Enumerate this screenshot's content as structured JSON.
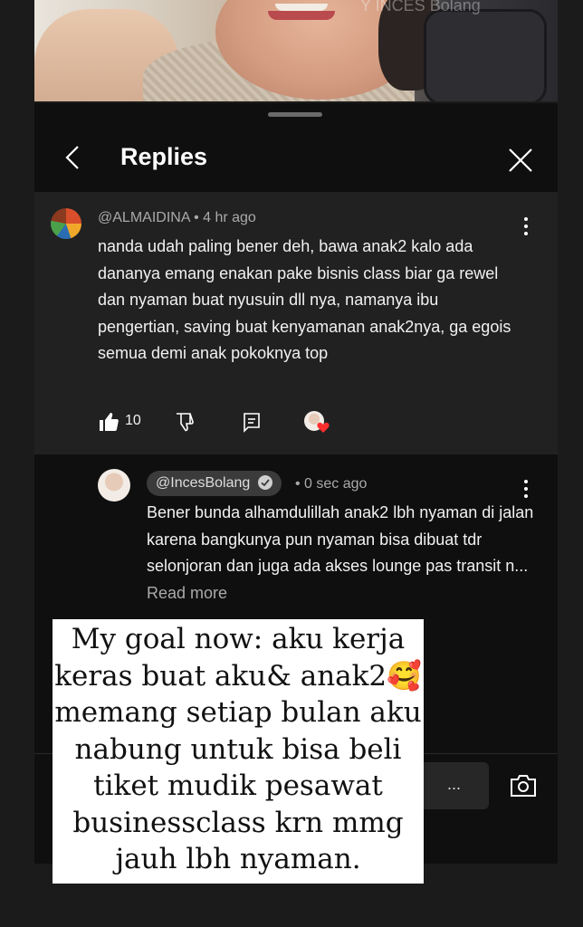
{
  "watermark": "Y INCES Bolang",
  "header": {
    "title": "Replies"
  },
  "comment": {
    "author": "@ALMAIDINA",
    "time": "4 hr ago",
    "text": "nanda udah paling bener deh, bawa anak2 kalo ada dananya emang enakan pake bisnis class biar ga rewel dan nyaman buat nyusuin dll nya, namanya ibu pengertian, saving buat kenyamanan anak2nya, ga egois semua demi anak pokoknya top",
    "likes": "10"
  },
  "reply": {
    "author": "@IncesBolang",
    "time": "0 sec ago",
    "text": "Bener bunda alhamdulillah anak2 lbh nyaman di jalan karena bangkunya pun nyaman bisa dibuat tdr selonjoran dan juga ada akses lounge pas transit n...",
    "read_more": "Read more"
  },
  "composer": {
    "more": "..."
  },
  "story": {
    "line1": "My goal now: aku kerja",
    "line2": "keras buat aku& anak2",
    "emoji": "🥰",
    "line3": "memang setiap bulan aku",
    "line4": "nabung untuk bisa beli",
    "line5": "tiket mudik pesawat",
    "line6": "businessclass krn mmg",
    "line7": "jauh lbh nyaman."
  },
  "icons": {
    "back": "chevron-left-icon",
    "close": "close-icon",
    "like": "thumb-up-icon",
    "dislike": "thumb-down-icon",
    "reply": "comment-icon",
    "heart": "creator-heart-icon",
    "more": "more-vert-icon",
    "verified": "verified-check-icon",
    "camera": "camera-icon"
  }
}
